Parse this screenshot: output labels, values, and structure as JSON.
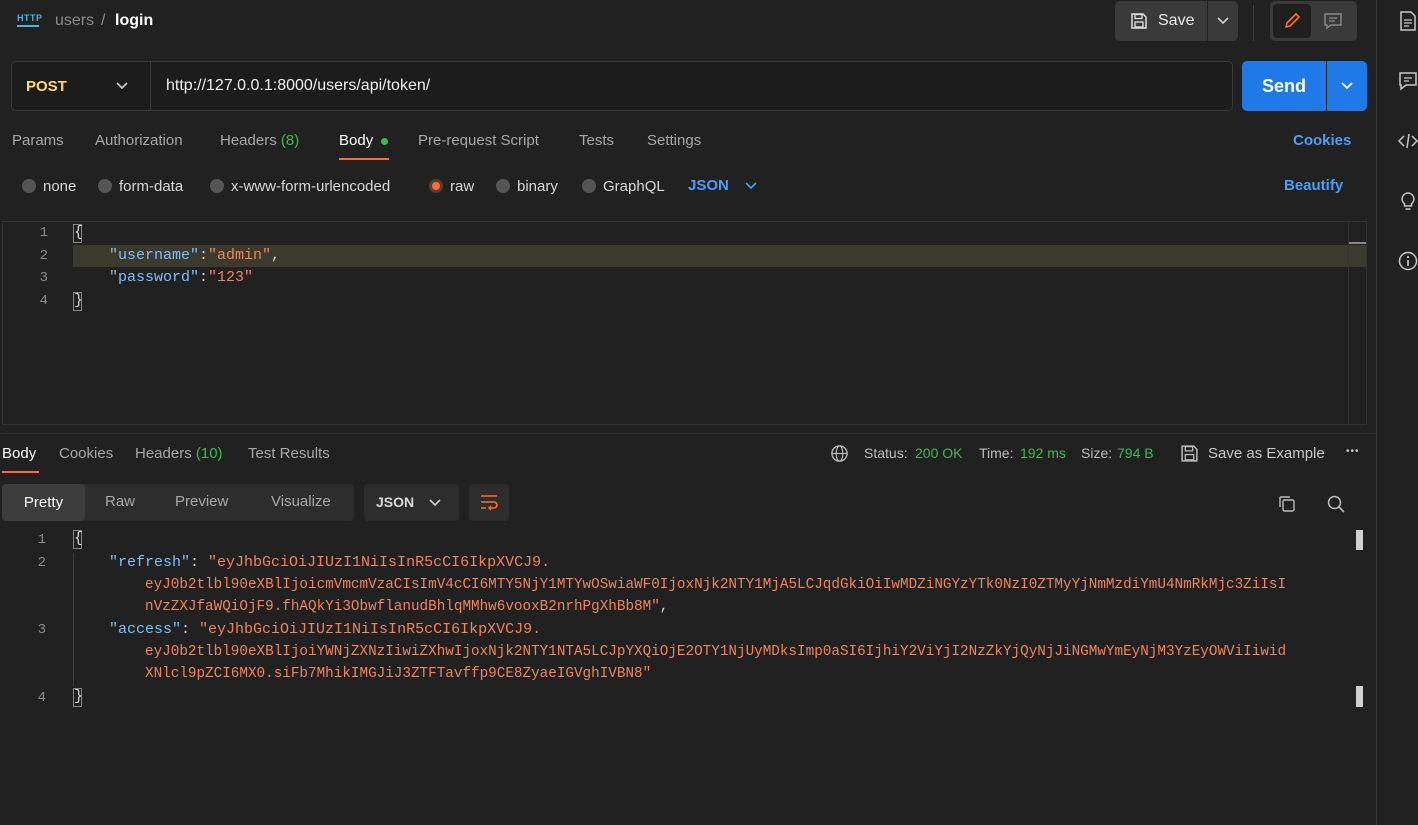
{
  "breadcrumb": {
    "badge": "HTTP",
    "parent": "users",
    "separator": "/",
    "current": "login"
  },
  "toolbar": {
    "save_label": "Save"
  },
  "request": {
    "method": "POST",
    "url": "http://127.0.0.1:8000/users/api/token/",
    "send_label": "Send",
    "tabs": {
      "params": "Params",
      "authorization": "Authorization",
      "headers": "Headers",
      "headers_count": "(8)",
      "body": "Body",
      "pre_request": "Pre-request Script",
      "tests": "Tests",
      "settings": "Settings"
    },
    "cookies_link": "Cookies",
    "body_types": {
      "none": "none",
      "form_data": "form-data",
      "urlencoded": "x-www-form-urlencoded",
      "raw": "raw",
      "binary": "binary",
      "graphql": "GraphQL"
    },
    "selected_body_type": "raw",
    "raw_format": "JSON",
    "beautify_label": "Beautify",
    "editor": {
      "line_numbers": [
        "1",
        "2",
        "3",
        "4"
      ],
      "open_brace": "{",
      "close_brace": "}",
      "username_key": "\"username\"",
      "username_value": "\"admin\"",
      "password_key": "\"password\"",
      "password_value": "\"123\"",
      "colon": ":",
      "comma": ","
    }
  },
  "response": {
    "tabs": {
      "body": "Body",
      "cookies": "Cookies",
      "headers": "Headers",
      "headers_count": "(10)",
      "test_results": "Test Results"
    },
    "status_label": "Status:",
    "status_value": "200 OK",
    "time_label": "Time:",
    "time_value": "192 ms",
    "size_label": "Size:",
    "size_value": "794 B",
    "save_example_label": "Save as Example",
    "more_label": "•••",
    "view_modes": {
      "pretty": "Pretty",
      "raw": "Raw",
      "preview": "Preview",
      "visualize": "Visualize"
    },
    "format": "JSON",
    "editor": {
      "line_numbers": [
        "1",
        "2",
        "3",
        "4"
      ],
      "open_brace": "{",
      "close_brace": "}",
      "refresh_key": "\"refresh\"",
      "refresh_value_line1": "\"eyJhbGciOiJIUzI1NiIsInR5cCI6IkpXVCJ9.",
      "refresh_value_line2": "eyJ0b2tlbl90eXBlIjoicmVmcmVzaCIsImV4cCI6MTY5NjY1MTYwOSwiaWF0IjoxNjk2NTY1MjA5LCJqdGkiOiIwMDZiNGYzYTk0NzI0ZTMyYjNmMzdiYmU4NmRkMjc3ZiIsI",
      "refresh_value_line3": "nVzZXJfaWQiOjF9.fhAQkYi3ObwflanudBhlqMMhw6vooxB2nrhPgXhBb8M\"",
      "access_key": "\"access\"",
      "access_value_line1": "\"eyJhbGciOiJIUzI1NiIsInR5cCI6IkpXVCJ9.",
      "access_value_line2": "eyJ0b2tlbl90eXBlIjoiYWNjZXNzIiwiZXhwIjoxNjk2NTY1NTA5LCJpYXQiOjE2OTY1NjUyMDksImp0aSI6IjhiY2ViYjI2NzZkYjQyNjJiNGMwYmEyNjM3YzEyOWViIiwid",
      "access_value_line3": "XNlcl9pZCI6MX0.siFb7MhikIMGJiJ3ZTFTavffp9CE8ZyaeIGVghIVBN8\"",
      "colon": ": ",
      "comma": ","
    }
  },
  "colors": {
    "accent_orange": "#ff6c37",
    "accent_blue": "#1f7ae8",
    "status_green": "#3fb950",
    "method_yellow": "#ffd96a"
  },
  "icons": [
    "http-icon",
    "save-icon",
    "chevron-down-icon",
    "pencil-icon",
    "comment-icon",
    "document-icon",
    "chat-icon",
    "code-icon",
    "lightbulb-icon",
    "info-icon",
    "globe-icon",
    "copy-icon",
    "search-icon",
    "wrap-icon"
  ]
}
